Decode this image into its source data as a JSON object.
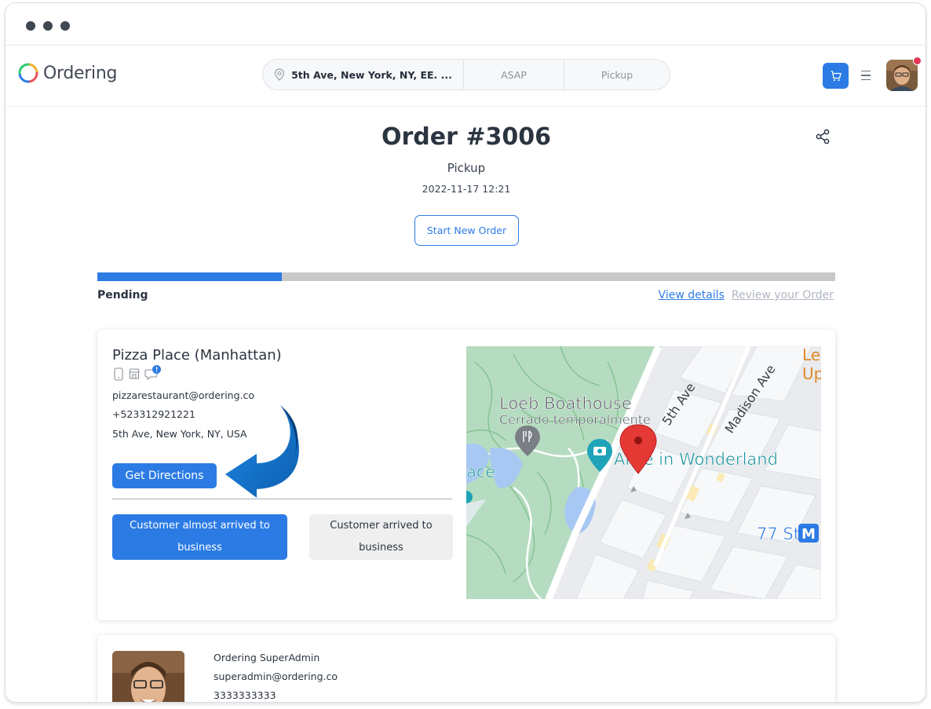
{
  "app": {
    "name": "Ordering"
  },
  "search": {
    "address": "5th Ave, New York, NY, EE. ...",
    "time": "ASAP",
    "mode": "Pickup"
  },
  "order": {
    "title": "Order #3006",
    "mode": "Pickup",
    "date": "2022-11-17 12:21",
    "start_new_label": "Start New Order",
    "status": "Pending",
    "progress": 0.25,
    "view_details_label": "View details",
    "review_label": "Review your Order"
  },
  "business": {
    "name": "Pizza Place (Manhattan)",
    "email": "pizzarestaurant@ordering.co",
    "phone": "+523312921221",
    "address": "5th Ave, New York, NY, USA",
    "directions_label": "Get Directions",
    "almost_arrived_label": "Customer almost arrived to business",
    "arrived_label": "Customer arrived to business",
    "icons": [
      "phone-icon",
      "store-icon",
      "chat-icon"
    ]
  },
  "map": {
    "labels": {
      "boathouse": "Loeb Boathouse",
      "boathouse_status": "Cerrado temporalmente",
      "alice": "Alice in Wonderland",
      "fifth_ave": "5th Ave",
      "madison": "Madison Ave",
      "station": "77 St",
      "metro": "M",
      "place_fragment": "ace",
      "corner_top": "Le",
      "corner_bottom": "Up"
    }
  },
  "customer": {
    "name": "Ordering SuperAdmin",
    "email": "superadmin@ordering.co",
    "phone": "3333333333"
  },
  "colors": {
    "accent": "#2c7be5",
    "notification": "#e63757",
    "map_park": "#b5dcc0",
    "map_pin": "#e53935"
  }
}
